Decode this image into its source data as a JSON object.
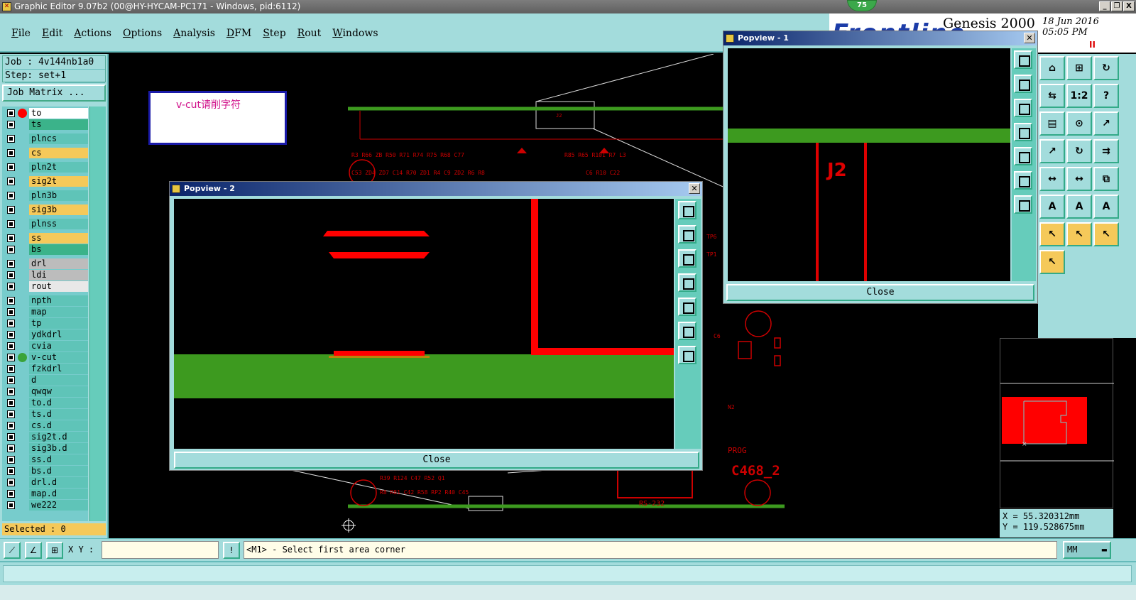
{
  "window": {
    "title": "Graphic Editor 9.07b2 (00@HY-HYCAM-PC171 - Windows, pid:6112)",
    "badge": "75",
    "buttons": [
      "_",
      "❐",
      "X"
    ]
  },
  "menubar": {
    "items": [
      "File",
      "Edit",
      "Actions",
      "Options",
      "Analysis",
      "DFM",
      "Step",
      "Rout",
      "Windows"
    ]
  },
  "brand": {
    "logo_text": "Frontline",
    "product": "Genesis 2000",
    "date": "18 Jun 2016",
    "time": "05:05 PM",
    "pause_glyph": "II"
  },
  "left_panel": {
    "job": "Job : 4v144nb1a0",
    "step": "Step: set+1",
    "job_matrix": "Job Matrix ...",
    "selected": "Selected : 0",
    "colors": {
      "board": "#5fc4b8",
      "signal": "#f5c95a",
      "mask": "#3bb38a",
      "drill": "#bcbcbc",
      "rout": "#e8e8e8",
      "doc": "#5fc4b8"
    },
    "layers": [
      {
        "name": "to",
        "bg": "#ffffff",
        "dot": "#ff0000"
      },
      {
        "name": "ts",
        "bg": "#3bb38a",
        "dot": ""
      },
      {
        "name": "plncs",
        "bg": "#5fc4b8",
        "dot": ""
      },
      {
        "name": "cs",
        "bg": "#f5c95a",
        "dot": ""
      },
      {
        "name": "pln2t",
        "bg": "#5fc4b8",
        "dot": ""
      },
      {
        "name": "sig2t",
        "bg": "#f5c95a",
        "dot": ""
      },
      {
        "name": "pln3b",
        "bg": "#5fc4b8",
        "dot": ""
      },
      {
        "name": "sig3b",
        "bg": "#f5c95a",
        "dot": ""
      },
      {
        "name": "plnss",
        "bg": "#5fc4b8",
        "dot": ""
      },
      {
        "name": "ss",
        "bg": "#f5c95a",
        "dot": ""
      },
      {
        "name": "bs",
        "bg": "#3bb38a",
        "dot": ""
      },
      {
        "name": "drl",
        "bg": "#bcbcbc",
        "dot": ""
      },
      {
        "name": "ldi",
        "bg": "#bcbcbc",
        "dot": ""
      },
      {
        "name": "rout",
        "bg": "#e8e8e8",
        "dot": ""
      },
      {
        "name": "npth",
        "bg": "#5fc4b8",
        "dot": ""
      },
      {
        "name": "map",
        "bg": "#5fc4b8",
        "dot": ""
      },
      {
        "name": "tp",
        "bg": "#5fc4b8",
        "dot": ""
      },
      {
        "name": "ydkdrl",
        "bg": "#5fc4b8",
        "dot": ""
      },
      {
        "name": "cvia",
        "bg": "#5fc4b8",
        "dot": ""
      },
      {
        "name": "v-cut",
        "bg": "#5fc4b8",
        "dot": "#3aa33a"
      },
      {
        "name": "fzkdrl",
        "bg": "#5fc4b8",
        "dot": ""
      },
      {
        "name": "d",
        "bg": "#5fc4b8",
        "dot": ""
      },
      {
        "name": "qwqw",
        "bg": "#5fc4b8",
        "dot": ""
      },
      {
        "name": "to.d",
        "bg": "#5fc4b8",
        "dot": ""
      },
      {
        "name": "ts.d",
        "bg": "#5fc4b8",
        "dot": ""
      },
      {
        "name": "cs.d",
        "bg": "#5fc4b8",
        "dot": ""
      },
      {
        "name": "sig2t.d",
        "bg": "#5fc4b8",
        "dot": ""
      },
      {
        "name": "sig3b.d",
        "bg": "#5fc4b8",
        "dot": ""
      },
      {
        "name": "ss.d",
        "bg": "#5fc4b8",
        "dot": ""
      },
      {
        "name": "bs.d",
        "bg": "#5fc4b8",
        "dot": ""
      },
      {
        "name": "drl.d",
        "bg": "#5fc4b8",
        "dot": ""
      },
      {
        "name": "map.d",
        "bg": "#5fc4b8",
        "dot": ""
      },
      {
        "name": "we222",
        "bg": "#5fc4b8",
        "dot": ""
      }
    ]
  },
  "canvas": {
    "note_text": "v-cut请削字符",
    "labels": [
      "J2",
      "C468_2",
      "PROG",
      "RS-232"
    ]
  },
  "popview2": {
    "title": "Popview - 2",
    "close_label": "Close"
  },
  "popview1": {
    "title": "Popview - 1",
    "close_label": "Close",
    "label": "J2"
  },
  "toolbox": {
    "buttons": [
      "⌂",
      "⊞",
      "↻",
      "⇆",
      "1:2",
      "?",
      "▤",
      "⊙",
      "↗",
      "↗",
      "↻",
      "⇉",
      "↔",
      "↔",
      "⧉",
      "A",
      "A",
      "A",
      "↖",
      "↖",
      "↖",
      "↖"
    ]
  },
  "coords": {
    "x": "X =  55.320312mm",
    "y": "Y = 119.528675mm"
  },
  "bottombar": {
    "xy_label": "X Y :",
    "xy_value": "",
    "prompt": "<M1> - Select first area corner",
    "units": "MM"
  }
}
